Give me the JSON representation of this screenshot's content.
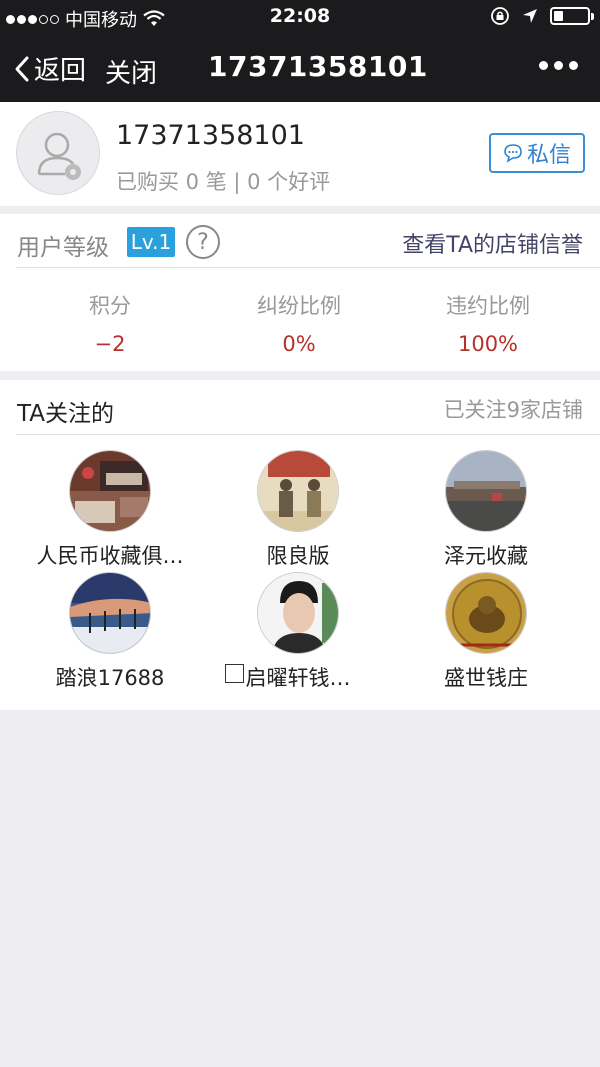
{
  "status_bar": {
    "carrier": "中国移动",
    "time": "22:08",
    "icons": [
      "signal-dots-icon",
      "wifi-icon",
      "rotation-lock-icon",
      "location-arrow-icon",
      "battery-icon"
    ]
  },
  "nav": {
    "back_label": "返回",
    "close_label": "关闭",
    "title": "17371358101",
    "more_icon": "more-dots-icon"
  },
  "profile": {
    "avatar_icon": "user-placeholder-icon",
    "name": "17371358101",
    "stats": "已购买 0 笔 | 0 个好评",
    "message_button": "私信"
  },
  "level": {
    "label": "用户等级",
    "badge": "Lv.1",
    "help_icon": "?",
    "store_credit_link": "查看TA的店铺信誉",
    "metrics": [
      {
        "label": "积分",
        "value": "−2"
      },
      {
        "label": "纠纷比例",
        "value": "0%"
      },
      {
        "label": "违约比例",
        "value": "100%"
      }
    ],
    "value_color": "#b5312b"
  },
  "following": {
    "title": "TA关注的",
    "count_text": "已关注9家店铺",
    "shops": [
      {
        "name": "人民币收藏俱…"
      },
      {
        "name": "限良版"
      },
      {
        "name": "泽元收藏"
      },
      {
        "name": "踏浪17688"
      },
      {
        "name": "启曜轩钱…"
      },
      {
        "name": "盛世钱庄"
      }
    ]
  },
  "colors": {
    "nav_bg": "#1b1b1d",
    "accent_blue": "#2f83cf",
    "badge_blue": "#2aa0dc",
    "page_bg": "#eeeef2"
  }
}
